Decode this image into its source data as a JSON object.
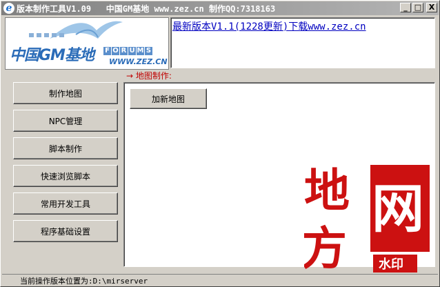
{
  "window": {
    "title": "版本制作工具V1.09   中国GM基地 www.zez.cn 制作QQ:7318163",
    "minimize_glyph": "_",
    "maximize_glyph": "□",
    "close_glyph": "X"
  },
  "banner": {
    "logo_text": "中国GM基地",
    "forums_letters": [
      "F",
      "O",
      "R",
      "U",
      "M",
      "S"
    ],
    "url_text": "WWW.ZEZ.CN"
  },
  "news": {
    "link_text": "最新版本V1.1(1228更新)下载www.zez.cn"
  },
  "section": {
    "label": "→ 地图制作:"
  },
  "sidebar": {
    "items": [
      {
        "label": "制作地图"
      },
      {
        "label": "NPC管理"
      },
      {
        "label": "脚本制作"
      },
      {
        "label": "快速浏览脚本"
      },
      {
        "label": "常用开发工具"
      },
      {
        "label": "程序基础设置"
      }
    ]
  },
  "panel": {
    "add_map_label": "加新地图"
  },
  "watermark": {
    "chars": [
      "地",
      "方",
      "网"
    ],
    "stamp_text": "水印",
    "color": "#cc1111"
  },
  "status": {
    "text": "当前操作版本位置为:D:\\mirserver"
  }
}
